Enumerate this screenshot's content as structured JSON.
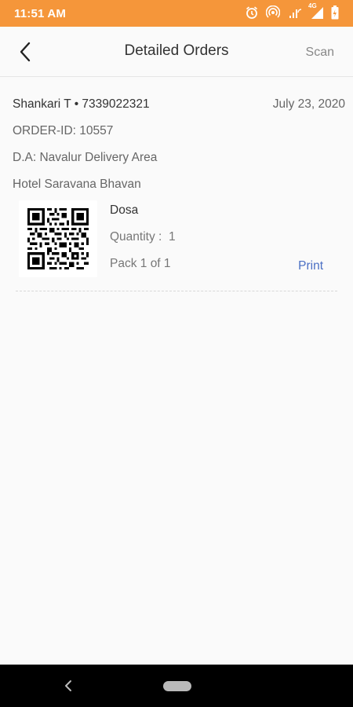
{
  "status_bar": {
    "time": "11:51 AM",
    "network_label": "4G",
    "icons": [
      "alarm-icon",
      "hotspot-icon",
      "signal-icon",
      "battery-icon"
    ],
    "background": "#f5963a"
  },
  "app_bar": {
    "title": "Detailed Orders",
    "scan_label": "Scan",
    "back_icon": "chevron-left-icon"
  },
  "order": {
    "customer": "Shankari T • 7339022321",
    "date": "July 23, 2020",
    "order_id": "ORDER-ID: 10557",
    "delivery_area": "D.A: Navalur Delivery Area",
    "hotel": "Hotel Saravana Bhavan",
    "item": {
      "name": "Dosa",
      "quantity": "Quantity :  1",
      "pack": "Pack 1 of 1",
      "print_label": "Print",
      "qr_icon": "qr-code-icon"
    }
  },
  "nav_bar": {
    "icons": [
      "nav-back-icon",
      "nav-home-icon"
    ]
  },
  "colors": {
    "accent": "#f5963a",
    "link": "#4a6fc4"
  }
}
